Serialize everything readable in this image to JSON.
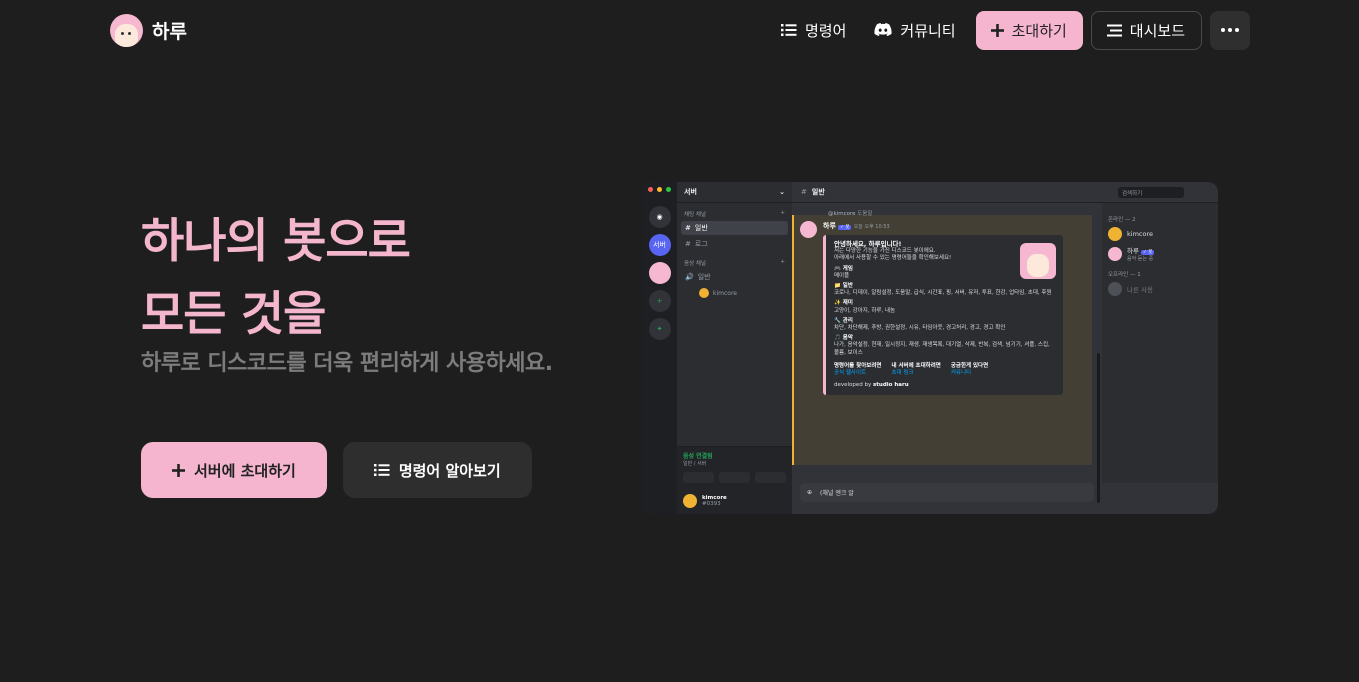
{
  "brand": {
    "name": "하루"
  },
  "nav": {
    "commands": "명령어",
    "community": "커뮤니티",
    "invite": "초대하기",
    "dashboard": "대시보드",
    "more_icon": "more-horizontal-icon"
  },
  "hero": {
    "line1": "하나의 봇으로",
    "line2": "모든 것을",
    "subtitle": "하루로 디스코드를 더욱 편리하게 사용하세요.",
    "cta_invite": "서버에 초대하기",
    "cta_commands": "명령어 알아보기"
  },
  "preview": {
    "server_name": "서버",
    "rail_server_label": "서버",
    "text_category": "채팅 채널",
    "channels": [
      "일반",
      "로그"
    ],
    "voice_category": "음성 채널",
    "voice_channel": "일반",
    "voice_user": "kimcore",
    "voice_status": "음성 연결됨",
    "voice_status_sub": "일반 / 서버",
    "self_name": "kimcore",
    "self_tag": "#0393",
    "channel_title": "일반",
    "search_placeholder": "검색하기",
    "reply_user": "@kimcore",
    "reply_text": "도움말",
    "bot_name": "하루",
    "bot_badge": "✓ 봇",
    "bot_time": "오늘 오후 10:53",
    "embed_title": "안녕하세요, 하루입니다!",
    "embed_desc1": "저는 다양한 기능을 가진 디스코드 봇이에요.",
    "embed_desc2": "아래에서 사용할 수 있는 명령어들을 확인해보세요!",
    "sections": [
      {
        "title": "🎮 게임",
        "body": "메이플"
      },
      {
        "title": "📁 일반",
        "body": "코로나, 디데이, 알림설정, 도움말, 급식, 시간표, 핑, 서버, 유저, 투표, 한강, 업타임, 초대, 후원"
      },
      {
        "title": "✨ 재미",
        "body": "고양이, 강아지, 하루, 내놈"
      },
      {
        "title": "🔧 관리",
        "body": "차단, 차단해제, 추방, 권한설정, 시유, 타임아웃, 경고처리, 경고, 경고 확인"
      },
      {
        "title": "🎵 음악",
        "body": "나가, 음악설정, 현재, 일시정지, 재생, 재생목록, 대기열, 삭제, 반복, 검색, 넘기기, 셔플, 스킵, 볼륨, 보이스"
      }
    ],
    "footer_links": [
      {
        "head": "명령어를 찾아보려면",
        "link": "공식 웹사이트"
      },
      {
        "head": "내 서버에 초대하려면",
        "link": "초대 링크"
      },
      {
        "head": "궁금한게 있다면",
        "link": "커뮤니티"
      }
    ],
    "developed_by": "developed by",
    "studio": "studio haru",
    "input_text": "(채널 엔크 알",
    "members_online": "온라인 — 2",
    "member1": "kimcore",
    "member2": "하루",
    "member2_badge": "✓ 봇",
    "member2_status": "음악 듣는 중",
    "members_offline": "오프라인 — 1",
    "member3": "나른 사용"
  }
}
